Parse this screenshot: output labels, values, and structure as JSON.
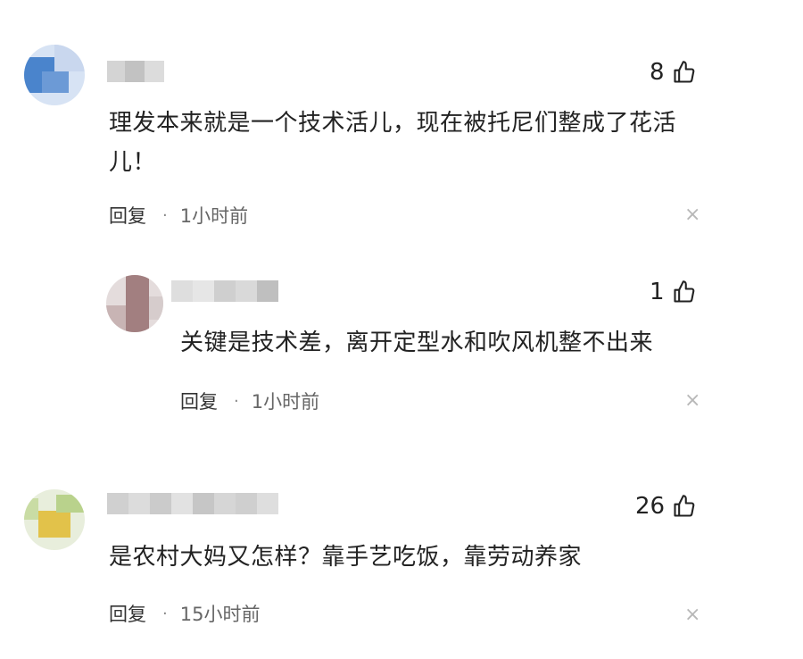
{
  "comments": [
    {
      "likes": "8",
      "text": "理发本来就是一个技术活儿，现在被托尼们整成了花活儿！",
      "reply_label": "回复",
      "dot": "·",
      "time": "1小时前",
      "close": "×"
    },
    {
      "likes": "1",
      "text": "关键是技术差，离开定型水和吹风机整不出来",
      "reply_label": "回复",
      "dot": "·",
      "time": "1小时前",
      "close": "×"
    },
    {
      "likes": "26",
      "text": "是农村大妈又怎样？靠手艺吃饭，靠劳动养家",
      "reply_label": "回复",
      "dot": "·",
      "time": "15小时前",
      "close": "×"
    }
  ],
  "icons": {
    "like": "thumbs-up-icon",
    "close": "close-icon"
  },
  "colors": {
    "text": "#222222",
    "meta": "#666666",
    "close": "#b8b8b8"
  }
}
